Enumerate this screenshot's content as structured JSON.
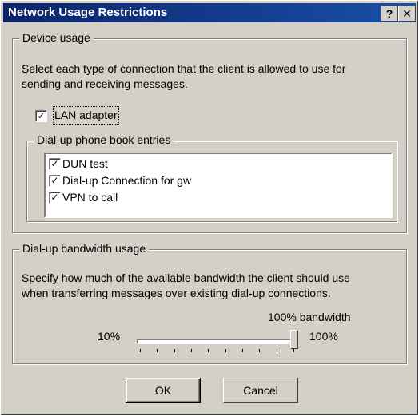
{
  "window": {
    "title": "Network Usage Restrictions",
    "help_glyph": "?",
    "close_glyph": "✕"
  },
  "device_usage": {
    "legend": "Device usage",
    "description_line1": "Select each type of connection that the client is allowed to use for",
    "description_line2": "sending and receiving messages.",
    "lan_adapter": {
      "label": "LAN adapter",
      "checked": true
    },
    "phonebook": {
      "legend": "Dial-up phone book entries",
      "items": [
        {
          "label": "DUN test",
          "checked": true
        },
        {
          "label": "Dial-up Connection for gw",
          "checked": true
        },
        {
          "label": "VPN to call",
          "checked": true
        }
      ]
    }
  },
  "bandwidth": {
    "legend": "Dial-up bandwidth usage",
    "description_line1": "Specify how much of the available bandwidth the client should use",
    "description_line2": "when transferring messages over existing dial-up connections.",
    "current_label": "100% bandwidth",
    "min_label": "10%",
    "max_label": "100%",
    "value_percent": 100
  },
  "buttons": {
    "ok": "OK",
    "cancel": "Cancel"
  },
  "colors": {
    "titlebar": "#0a246a",
    "face": "#d4d0c8"
  }
}
